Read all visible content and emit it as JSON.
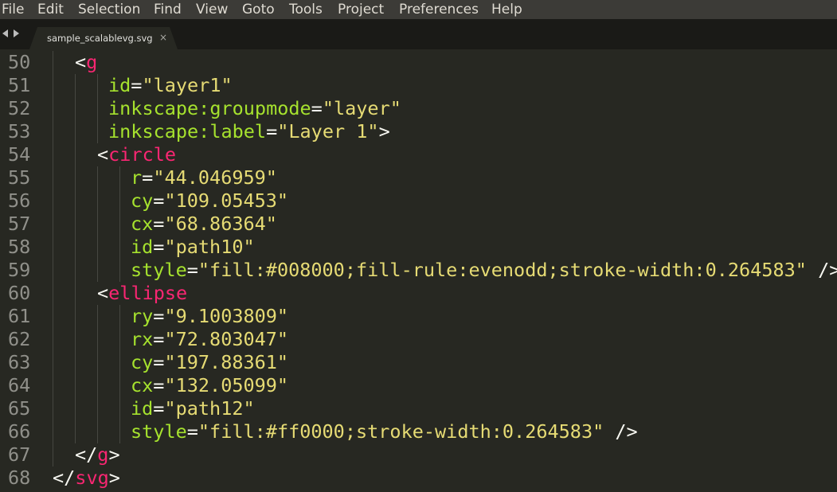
{
  "menubar": {
    "items": [
      "File",
      "Edit",
      "Selection",
      "Find",
      "View",
      "Goto",
      "Tools",
      "Project",
      "Preferences",
      "Help"
    ]
  },
  "tabbar": {
    "nav_left_icon": "arrow-left-icon",
    "nav_right_icon": "arrow-right-icon",
    "tab_title": "sample_scalablevg.svg",
    "tab_close": "×"
  },
  "theme": {
    "background": "#272822",
    "tag": "#f92672",
    "attribute": "#a6e22e",
    "string": "#e6db74",
    "text": "#f8f8f2",
    "line_number": "#90908a"
  },
  "editor": {
    "lines": [
      {
        "n": "50",
        "tokens": [
          {
            "t": "<",
            "k": "punct"
          },
          {
            "t": "g",
            "k": "tag"
          }
        ]
      },
      {
        "n": "51",
        "tokens": [
          {
            "t": "id",
            "k": "attr"
          },
          {
            "t": "=",
            "k": "punct"
          },
          {
            "t": "\"layer1\"",
            "k": "str"
          }
        ]
      },
      {
        "n": "52",
        "tokens": [
          {
            "t": "inkscape:groupmode",
            "k": "attr"
          },
          {
            "t": "=",
            "k": "punct"
          },
          {
            "t": "\"layer\"",
            "k": "str"
          }
        ]
      },
      {
        "n": "53",
        "tokens": [
          {
            "t": "inkscape:label",
            "k": "attr"
          },
          {
            "t": "=",
            "k": "punct"
          },
          {
            "t": "\"Layer 1\"",
            "k": "str"
          },
          {
            "t": ">",
            "k": "punct"
          }
        ]
      },
      {
        "n": "54",
        "tokens": [
          {
            "t": "<",
            "k": "punct"
          },
          {
            "t": "circle",
            "k": "tag"
          }
        ]
      },
      {
        "n": "55",
        "tokens": [
          {
            "t": "r",
            "k": "attr"
          },
          {
            "t": "=",
            "k": "punct"
          },
          {
            "t": "\"44.046959\"",
            "k": "str"
          }
        ]
      },
      {
        "n": "56",
        "tokens": [
          {
            "t": "cy",
            "k": "attr"
          },
          {
            "t": "=",
            "k": "punct"
          },
          {
            "t": "\"109.05453\"",
            "k": "str"
          }
        ]
      },
      {
        "n": "57",
        "tokens": [
          {
            "t": "cx",
            "k": "attr"
          },
          {
            "t": "=",
            "k": "punct"
          },
          {
            "t": "\"68.86364\"",
            "k": "str"
          }
        ]
      },
      {
        "n": "58",
        "tokens": [
          {
            "t": "id",
            "k": "attr"
          },
          {
            "t": "=",
            "k": "punct"
          },
          {
            "t": "\"path10\"",
            "k": "str"
          }
        ]
      },
      {
        "n": "59",
        "tokens": [
          {
            "t": "style",
            "k": "attr"
          },
          {
            "t": "=",
            "k": "punct"
          },
          {
            "t": "\"fill:#008000;fill-rule:evenodd;stroke-width:0.264583\"",
            "k": "str"
          },
          {
            "t": " />",
            "k": "punct"
          }
        ]
      },
      {
        "n": "60",
        "tokens": [
          {
            "t": "<",
            "k": "punct"
          },
          {
            "t": "ellipse",
            "k": "tag"
          }
        ]
      },
      {
        "n": "61",
        "tokens": [
          {
            "t": "ry",
            "k": "attr"
          },
          {
            "t": "=",
            "k": "punct"
          },
          {
            "t": "\"9.1003809\"",
            "k": "str"
          }
        ]
      },
      {
        "n": "62",
        "tokens": [
          {
            "t": "rx",
            "k": "attr"
          },
          {
            "t": "=",
            "k": "punct"
          },
          {
            "t": "\"72.803047\"",
            "k": "str"
          }
        ]
      },
      {
        "n": "63",
        "tokens": [
          {
            "t": "cy",
            "k": "attr"
          },
          {
            "t": "=",
            "k": "punct"
          },
          {
            "t": "\"197.88361\"",
            "k": "str"
          }
        ]
      },
      {
        "n": "64",
        "tokens": [
          {
            "t": "cx",
            "k": "attr"
          },
          {
            "t": "=",
            "k": "punct"
          },
          {
            "t": "\"132.05099\"",
            "k": "str"
          }
        ]
      },
      {
        "n": "65",
        "tokens": [
          {
            "t": "id",
            "k": "attr"
          },
          {
            "t": "=",
            "k": "punct"
          },
          {
            "t": "\"path12\"",
            "k": "str"
          }
        ]
      },
      {
        "n": "66",
        "tokens": [
          {
            "t": "style",
            "k": "attr"
          },
          {
            "t": "=",
            "k": "punct"
          },
          {
            "t": "\"fill:#ff0000;stroke-width:0.264583\"",
            "k": "str"
          },
          {
            "t": " />",
            "k": "punct"
          }
        ]
      },
      {
        "n": "67",
        "tokens": [
          {
            "t": "</",
            "k": "punct"
          },
          {
            "t": "g",
            "k": "tag"
          },
          {
            "t": ">",
            "k": "punct"
          }
        ]
      },
      {
        "n": "68",
        "tokens": [
          {
            "t": "</",
            "k": "punct"
          },
          {
            "t": "svg",
            "k": "tag"
          },
          {
            "t": ">",
            "k": "punct"
          }
        ]
      }
    ]
  }
}
